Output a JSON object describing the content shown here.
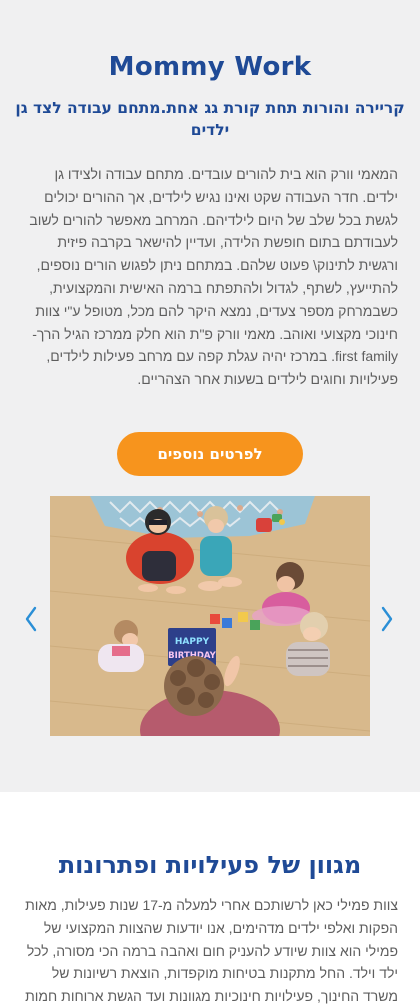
{
  "hero": {
    "title": "Mommy Work",
    "subtitle": "קריירה והורות תחת קורת גג אחת.מתחם עבודה לצד גן ילדים",
    "body": "המאמי וורק הוא בית להורים עובדים. מתחם עבודה ולצידו גן ילדים. חדר העבודה שקט ואינו נגיש לילדים, אך ההורים יכולים לגשת בכל שלב של היום לילדיהם. המרחב מאפשר להורים לשוב לעבודתם בתום חופשת הלידה, ועדיין להישאר בקרבה פיזית ורגשית לתינוק\\ פעוט שלהם. במתחם ניתן לפגוש הורים נוספים, להתייעץ, לשתף, לגדול ולהתפתח ברמה האישית והמקצועית, כשבמרחק מספר צעדים, נמצא היקר להם מכל, מטופל ע\"י צוות חינוכי מקצועי ואוהב. מאמי וורק פ\"ת הוא חלק ממרכז הגיל הרך- first family. במרכז יהיה עגלת קפה עם מרחב פעילות לילדים, פעילויות וחוגים לילדים בשעות אחר הצהריים.",
    "cta_label": "לפרטים נוספים"
  },
  "slider": {
    "slide_caption": "HAPPY BIRTHDAY",
    "prev_icon": "chevron-left-icon",
    "next_icon": "chevron-right-icon"
  },
  "activities": {
    "title": "מגוון של פעילויות ופתרונות",
    "body": "צוות פמילי כאן לרשותכם אחרי למעלה מ-17 שנות פעילות, מאות הפקות ואלפי ילדים מדהימים, אנו יודעות שהצוות המקצועי של פמילי הוא צוות שיודע להעניק חום ואהבה ברמה הכי מסורה, לכל ילד וילד. החל מתקנות בטיחות מוקפדות, הוצאת רשיונות של משרד החינוך, פעילויות חינוכיות מגוונות ועד הגשת ארוחות חמות"
  },
  "colors": {
    "brand_blue": "#1f4a96",
    "accent_orange": "#f7941d",
    "hero_bg": "#f0f0f1",
    "arrow_blue": "#2b8fd6"
  }
}
